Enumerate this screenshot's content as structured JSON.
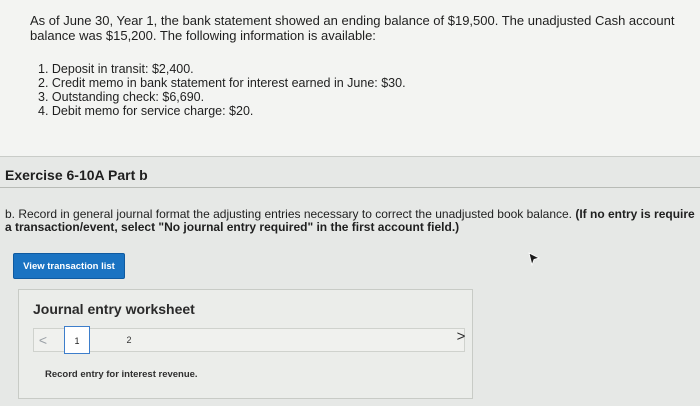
{
  "problem": {
    "intro": "As of June 30, Year 1, the bank statement showed an ending balance of $19,500. The unadjusted Cash account balance was $15,200. The following information is available:",
    "items": [
      "1. Deposit in transit: $2,400.",
      "2. Credit memo in bank statement for interest earned in June: $30.",
      "3. Outstanding check: $6,690.",
      "4. Debit memo for service charge: $20."
    ]
  },
  "exercise": {
    "title": "Exercise 6-10A Part b"
  },
  "instruction": {
    "text_plain": "b. Record in general journal format the adjusting entries necessary to correct the unadjusted book balance. ",
    "text_bold_1": "(If no entry is required fo",
    "text_bold_2": "a transaction/event, select \"No journal entry required\" in the first account field.)"
  },
  "buttons": {
    "view_transaction_list": "View transaction list"
  },
  "worksheet": {
    "title": "Journal entry worksheet",
    "pages": [
      "1",
      "2"
    ],
    "active_page": "1",
    "prev_glyph": "<",
    "next_glyph": ">",
    "record_text": "Record entry for interest revenue."
  },
  "colors": {
    "accent": "#1a73c2",
    "active_tab_border": "#3d7ecb"
  }
}
